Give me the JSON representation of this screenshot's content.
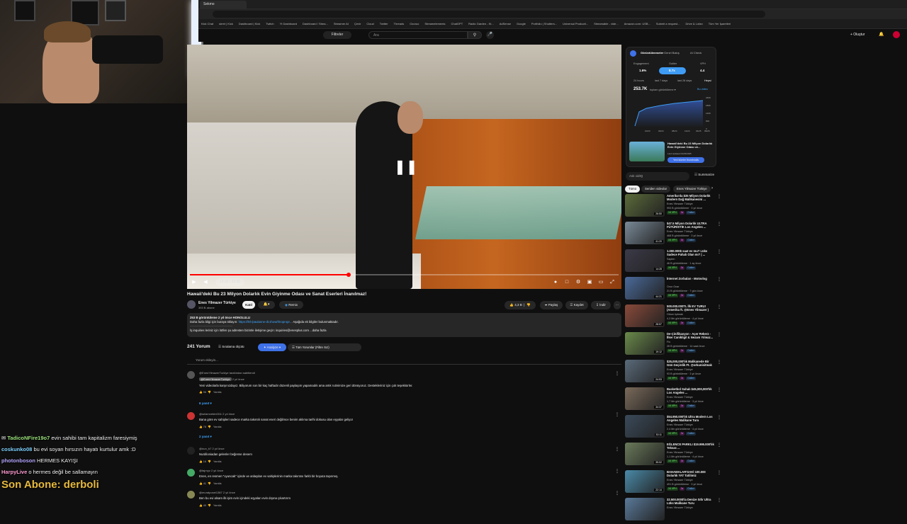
{
  "browser": {
    "tab_title": "Sekmo",
    "bookmarks": [
      "Kick Chat",
      "sirret | Kick",
      "Dashboard | Kick",
      "Twitch",
      "Yt Dashboard",
      "Dashboard / Strea...",
      "Streamer AI",
      "Çevir",
      "Cloud",
      "Twitter",
      "Threads",
      "Ozoruo",
      "Streamelements",
      "ChatGPT",
      "Radio Garden - Kt...",
      "AdSense",
      "Google",
      "Portfolio | Shutters...",
      "Universal Productt...",
      "Streamable - vide...",
      "Amazon.com: USB...",
      "Submit a request...",
      "Drive & Lofan",
      "Tüm Yer İşaretleri"
    ]
  },
  "header": {
    "filters_label": "Filtreler",
    "search_placeholder": "Ara",
    "create_label": "+ Oluştur"
  },
  "player": {
    "progress_fraction": 0.37,
    "time_text": "12:32 / 33:30"
  },
  "video": {
    "title": "Hawaii'deki Bu 23 Milyon Dolarlık Evin Giyinme Odası ve Sanat Eserleri İnanılmaz!",
    "channel": "Enes Yilmazer Türkiye",
    "subscribers": "393 B abone",
    "join_label": "Katıl",
    "remix_label": "Remix",
    "likes": "4,3 B",
    "share_label": "Paylaş",
    "save_label": "Kaydet",
    "download_label": "İndir"
  },
  "description": {
    "line1": "253 B görüntüleme  2 yıl önce  HONOLULU",
    "line2_prefix": "Daha fazla bilgi için buraya tıklayın:",
    "line2_link": "https://l6l-/paulanne-dt.show/thropropr...",
    "line2_suffix": "Aşağıda ek bilgiler bulunmaktadır.",
    "line3": "İş inquiries leriniz için lütfen şu adresten bizimle iletişime geçin: inquiries@enesplus.com   ...daha fazla"
  },
  "comments": {
    "count": "241 Yorum",
    "sort_label": "Sıralama ölçütü",
    "analyze_label": "Analyze",
    "top_label": "Tüm Yorumlar (Filtre Sız)",
    "add_placeholder": "Yorum ekleyin...",
    "reply_label": "Yanıtla",
    "items": [
      {
        "meta": "@EnesYilmazerTurkiye tarafından sabitlendi",
        "handle": "@EnesYilmazerTurkiye",
        "time": "2 yıl önce",
        "text": "Yeni videolarla karşınızdayız. Biliyorum son bir kaç haftadır düzenli paylaşım yapamadık ama artık rutinimize geri dönüyoruz. Destekleriniz için çok teşekkürler.",
        "likes": "96",
        "replies": "6 yanıt"
      },
      {
        "meta": "@selamvetent311  2 yıl önce",
        "text": "Bana göre ev sahipleri sadece marka takıntılı sanat eseri değilmce benim aklıma tarihi dokusu olan eşyalar geliyor",
        "likes": "78",
        "replies": "2 yanıt"
      },
      {
        "meta": "@nun_b7  2 yıl önce",
        "text": "Nurdiloniadan gelenler beğense desem",
        "likes": "16"
      },
      {
        "meta": "@fajrnyz  2 yıl önce",
        "text": "Enes, en resmen \"oyuncak\" içinde ve anlaşılan ev sahiplerinin marka takıntısı farklı bir boyuta taşınmış.",
        "likes": "41"
      },
      {
        "meta": "@muratposei1387  2 yıl önce",
        "text": "Ben bu evi alsam ilk işim evin içindeki eşyaları evin dışına çıkartırım",
        "likes": "49"
      }
    ]
  },
  "vidiq": {
    "tabs": [
      "Görüntülenmeler",
      "Genel Bakış",
      "AI Check"
    ],
    "engagement_label": "Engagement",
    "engagement": "1.6%",
    "outlier_label": "Outlier",
    "outlier": "8.7x",
    "vph_label": "VPH",
    "vph": "4.4",
    "ranges": [
      "24 hours",
      "last 7 days",
      "last 28 days",
      "Hepsi"
    ],
    "views": "253.7K",
    "views_label": "toplam görüntüleme",
    "compare_label": "Bu video",
    "y_ticks": [
      "240K",
      "180K",
      "120K",
      "60K",
      "0"
    ],
    "x_ticks": [
      "10/23",
      "03/24",
      "08/24",
      "12/24",
      "04/25",
      "09/26"
    ],
    "thumb_title": "Hawaii'deki Bu 23 Milyon Dolarlık Evin Giyinme Odası ve...",
    "thumb_updated": "Last Updated 04/23/2025",
    "thumb_button": "Yeni kümler thumbnails"
  },
  "sidebar": {
    "ask_placeholder": "Ask vidIQ",
    "summarize_label": "Summarize",
    "chips": [
      "Tümü",
      "Seriden videolar",
      "Enes Yilmazer Türkiye"
    ],
    "recs": [
      {
        "title": "Amerika'da $35 Milyon Dolarlık Modern Dağ Malikanesini ...",
        "channel": "Enes Yilmazer Türkiye",
        "views": "993 B görüntüleme · 3 yıl önce",
        "dur": "26:50",
        "thumb": "#5b6b3a"
      },
      {
        "title": "$47.5 Milyon Dolarlık ULTRA FÜTÜRİSTİK Los Angeles ...",
        "channel": "Enes Yilmazer Türkiye",
        "views": "468 B görüntüleme · 3 yıl önce",
        "dur": "41:20",
        "thumb": "#7a8a98"
      },
      {
        "title": "1.000.000$ saat ev mu? Lüks Sadece Pahalı Olan mı? | ...",
        "channel": "Sapien",
        "views": "46 B görüntüleme · 1 ay önce",
        "dur": "14:28",
        "thumb": "#3b3a48"
      },
      {
        "title": "İnternet Zorbaları - Motovlog",
        "channel": "Onur Onar",
        "views": "21 B görüntüleme · 7 gün önce",
        "dur": "44:21",
        "thumb": "#4a6a9a"
      },
      {
        "title": "500.000.000TL İlk EV TURU! (Amerika ft. @Enes Yilmazer )",
        "channel": "Orkun Işıtmak",
        "views": "4,3 Mn görüntüleme · 4 yıl önce",
        "dur": "28:57",
        "thumb": "#8a4a3a"
      },
      {
        "title": "De-Çinifikasyon - Açer Rekerz - İlker Canikligil & Nezam Yılmaz...",
        "channel": "Flu",
        "views": "28 B görüntüleme · 14 saat önce",
        "dur": "19:12",
        "thumb": "#6a8a4a"
      },
      {
        "title": "$25,000,000'lık Malikanede Bir Gün Geçirdik Ft. @orkunisitmak",
        "channel": "Enes Yilmazer Türkiye",
        "views": "93 B görüntüleme · 3 yıl önce",
        "dur": "24:53",
        "thumb": "#5a6a7a"
      },
      {
        "title": "Basketbol Sahalı $45,000,000'lık Los Angeles ...",
        "channel": "Enes Yilmazer Türkiye",
        "views": "1,7 Mn görüntüleme · 3 yıl önce",
        "dur": "34:37",
        "thumb": "#7a6a5a"
      },
      {
        "title": "$54.950.000'lık Ultra Modern Los Angeles Malikane Turu",
        "channel": "Enes Yilmazer Türkiye",
        "views": "2,4 Mn görüntüleme · 4 yıl önce",
        "dur": "30:11",
        "thumb": "#3a4a5a"
      },
      {
        "title": "EĞLENCE PARKLI $19.995.000'lık Teksas ...",
        "channel": "Enes Yilmazer Türkiye",
        "views": "1,1 Mn görüntüleme · 4 yıl önce",
        "dur": "35:02",
        "thumb": "#6a7a5a"
      },
      {
        "title": "BAHAMALAR'DAKİ 100.000 Dolarlık YAT Tatilimiz",
        "channel": "Enes Yilmazer Türkiye",
        "views": "491 B görüntüleme · 3 yıl önce",
        "dur": "22:14",
        "thumb": "#4a8aa8"
      },
      {
        "title": "32.500.000$'la Denize Sıfır Ultra Lüks Malikane Turu",
        "channel": "Enes Yilmazer Türkiye",
        "views": "",
        "dur": "",
        "thumb": "#5a7a9a"
      }
    ],
    "badge_labels": [
      "1K VPH",
      "3x",
      "Outlier"
    ]
  },
  "chat": [
    {
      "user": "TadicoNFire19o7",
      "user_color": "#9be37c",
      "text": "evin sahibi tam kapitalizm faresiymiş"
    },
    {
      "user": "coskunko08",
      "user_color": "#7fd3ff",
      "text": "bu evi soyan hırsızın hayatı kurtulur amk :D"
    },
    {
      "user": "photonboson",
      "user_color": "#b6a6ff",
      "text": "HERMES KAYIŞI"
    },
    {
      "user": "HarpyLive",
      "user_color": "#ff9bd2",
      "text": "o hermes değil be sallamayın"
    }
  ],
  "overlay": {
    "last_sub": "Son Abone: derboli"
  },
  "colors": {
    "accent_red": "#ff0000",
    "link_blue": "#3ea6ff",
    "analyze_blue": "#3f71e8",
    "sub_gold": "#e6b93c"
  }
}
